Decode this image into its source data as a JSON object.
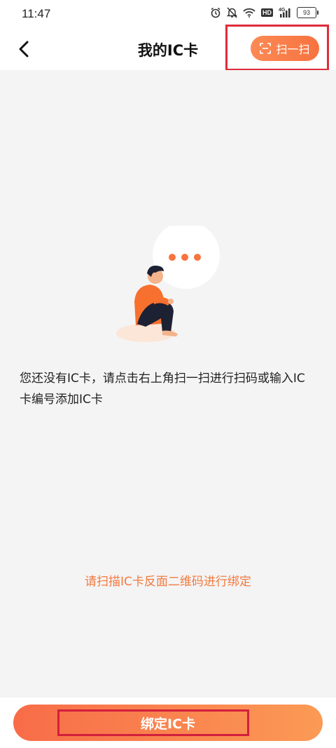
{
  "status_bar": {
    "time": "11:47",
    "battery": "93",
    "network_label": "4G",
    "hd_label": "HD"
  },
  "header": {
    "title": "我的IC卡",
    "back_icon": "chevron-left-icon",
    "scan_label": "扫一扫",
    "scan_icon": "scan-frame-icon"
  },
  "empty_state": {
    "message": "您还没有IC卡，请点击右上角扫一扫进行扫码或输入IC卡编号添加IC卡",
    "hint": "请扫描IC卡反面二维码进行绑定"
  },
  "bottom": {
    "bind_label": "绑定IC卡"
  },
  "colors": {
    "accent": "#f7733f",
    "hint": "#f27a3f",
    "highlight_box": "#e02c3c",
    "background": "#f4f4f4"
  }
}
